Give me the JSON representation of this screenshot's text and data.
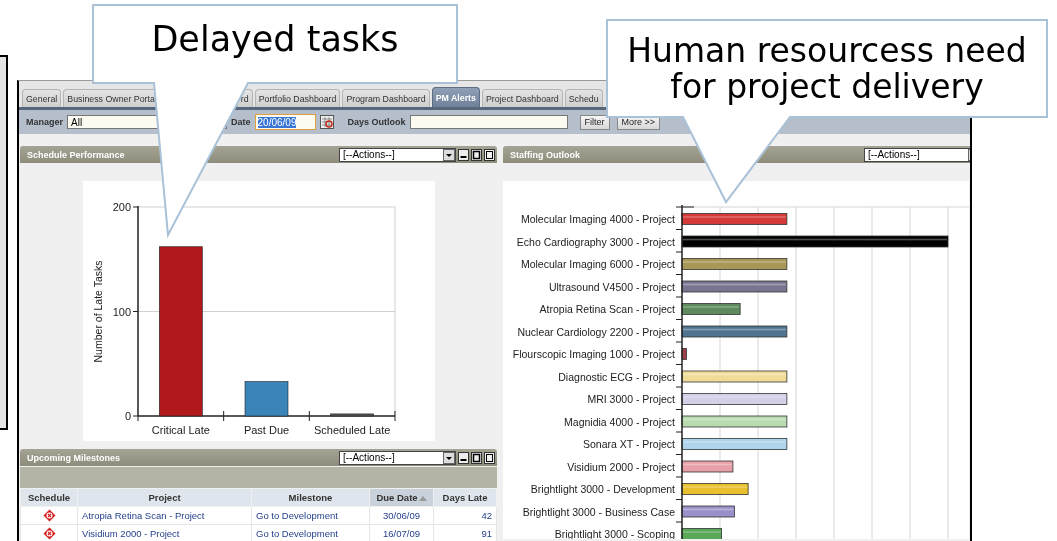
{
  "callouts": [
    {
      "text": "Delayed tasks"
    },
    {
      "text": "Human resourcess need for project delivery"
    }
  ],
  "tabs": [
    {
      "label": "General",
      "selected": false
    },
    {
      "label": "Business Owner Porta",
      "selected": false
    },
    {
      "label": "rd",
      "selected": false
    },
    {
      "label": "Portfolio Dashboard",
      "selected": false
    },
    {
      "label": "Program Dashboard",
      "selected": false
    },
    {
      "label": "PM Alerts",
      "selected": true
    },
    {
      "label": "Project Dashboard",
      "selected": false
    },
    {
      "label": "Schedu",
      "selected": false
    }
  ],
  "filters": {
    "manager_label": "Manager",
    "manager_value": "All",
    "date_label": "Date",
    "date_value": "20/06/09",
    "date_highlighted": true,
    "days_outlook_label": "Days Outlook",
    "buttons": [
      "Filter",
      "More >>"
    ]
  },
  "schedule_performance": {
    "title": "Schedule Performance",
    "actions": "[--Actions--]",
    "controls": true,
    "chart_data": {
      "type": "bar",
      "ylabel": "Number of Late Tasks",
      "categories": [
        "Critical Late",
        "Past Due",
        "Scheduled Late"
      ],
      "ylim": [
        0,
        200
      ],
      "yticks": [
        0,
        100,
        200
      ],
      "series": [
        {
          "color": "#b0181c",
          "values": [
            162,
            null,
            null
          ]
        },
        {
          "color": "#3a84b8",
          "values": [
            null,
            33,
            null
          ]
        },
        {
          "color": "#555555",
          "values": [
            null,
            null,
            2
          ]
        }
      ]
    }
  },
  "staffing_outlook": {
    "title": "Staffing Outlook",
    "actions": "[--Actions--]",
    "controls": false,
    "projects": [
      {
        "name": "Molecular Imaging 4000 - Project",
        "color": "#d43a3a"
      },
      {
        "name": "Echo Cardiography 3000 - Project",
        "color": "#000000"
      },
      {
        "name": "Molecular Imaging 6000 - Project",
        "color": "#a89858"
      },
      {
        "name": "Ultrasound V4500 - Project",
        "color": "#7a7490"
      },
      {
        "name": "Atropia Retina Scan - Project",
        "color": "#5e8a5e"
      },
      {
        "name": "Nuclear Cardiology 2200 - Project",
        "color": "#4e7490"
      },
      {
        "name": "Flourscopic Imaging 1000 - Project",
        "color": "#a04048"
      },
      {
        "name": "Diagnostic ECG - Project",
        "color": "#f0dc98"
      },
      {
        "name": "MRI 3000 - Project",
        "color": "#d4d0e8"
      },
      {
        "name": "Magnidia 4000 - Project",
        "color": "#b8dcb0"
      },
      {
        "name": "Sonara XT - Project",
        "color": "#b0d4ec"
      },
      {
        "name": "Visidium 2000 - Project",
        "color": "#e8a0a8"
      },
      {
        "name": "Brightlight 3000 - Development",
        "color": "#e8c030"
      },
      {
        "name": "Brightlight 3000 - Business Case",
        "color": "#9890c8"
      },
      {
        "name": "Brightlight 3000 - Scoping",
        "color": "#58a858"
      }
    ]
  },
  "upcoming_milestones": {
    "title": "Upcoming Milestones",
    "actions": "[--Actions--]",
    "controls": true,
    "columns": [
      {
        "label": "Schedule",
        "sorted": false
      },
      {
        "label": "Project",
        "sorted": false
      },
      {
        "label": "Milestone",
        "sorted": false
      },
      {
        "label": "Due Date",
        "sorted": true
      },
      {
        "label": "Days Late",
        "sorted": false
      }
    ],
    "rows": [
      {
        "project": "Atropia Retina Scan - Project",
        "milestone": "Go to Development",
        "due_date": "30/06/09",
        "days_late": "42"
      },
      {
        "project": "Visidium 2000 - Project",
        "milestone": "Go to Development",
        "due_date": "16/07/09",
        "days_late": "91"
      }
    ]
  }
}
